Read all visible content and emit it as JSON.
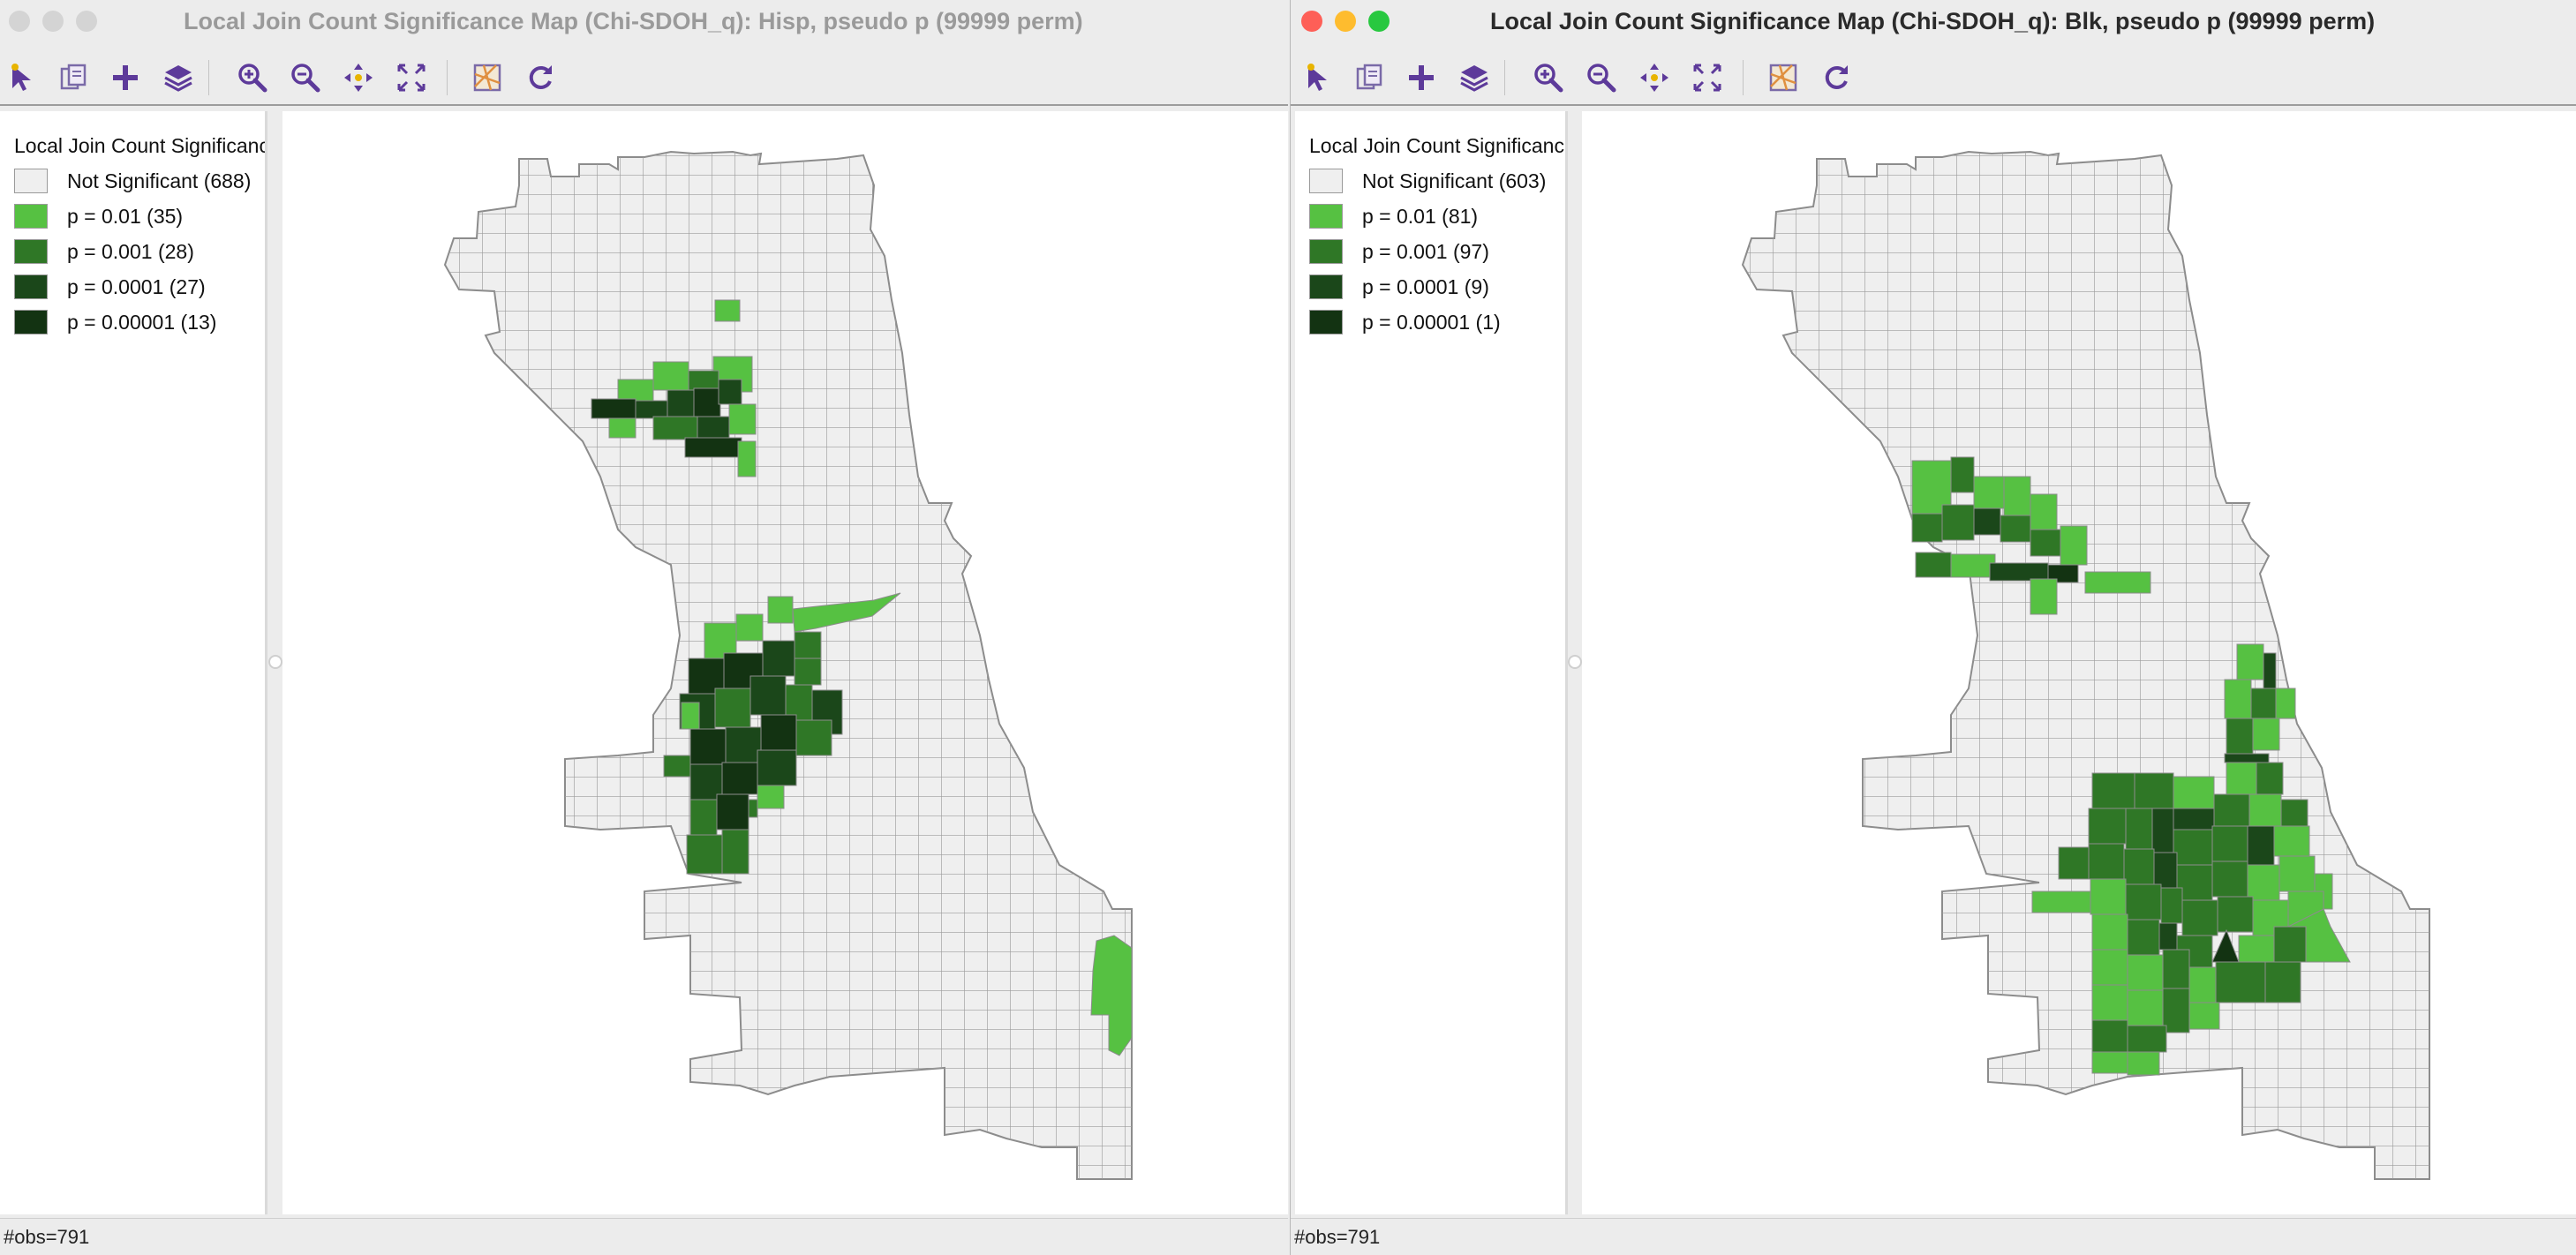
{
  "colors": {
    "not_significant": "#efefef",
    "p01": "#56c142",
    "p001": "#2f7726",
    "p0001": "#1b471a",
    "p00001": "#133312",
    "outline": "#999999",
    "toolbar_icon": "#5d3a9a"
  },
  "windows": [
    {
      "title": "Local Join Count Significance Map (Chi-SDOH_q): Hisp, pseudo p (99999 perm)",
      "active": false,
      "legend": {
        "title": "Local Join Count Significance Map",
        "items": [
          {
            "label": "Not Significant (688)",
            "color_key": "not_significant"
          },
          {
            "label": "p = 0.01 (35)",
            "color_key": "p01"
          },
          {
            "label": "p = 0.001 (28)",
            "color_key": "p001"
          },
          {
            "label": "p = 0.0001 (27)",
            "color_key": "p0001"
          },
          {
            "label": "p = 0.00001 (13)",
            "color_key": "p00001"
          }
        ]
      },
      "status": "#obs=791"
    },
    {
      "title": "Local Join Count Significance Map (Chi-SDOH_q): Blk, pseudo p (99999 perm)",
      "active": true,
      "legend": {
        "title": "Local Join Count Significance Map",
        "items": [
          {
            "label": "Not Significant (603)",
            "color_key": "not_significant"
          },
          {
            "label": "p = 0.01 (81)",
            "color_key": "p01"
          },
          {
            "label": "p = 0.001 (97)",
            "color_key": "p001"
          },
          {
            "label": "p = 0.0001 (9)",
            "color_key": "p0001"
          },
          {
            "label": "p = 0.00001 (1)",
            "color_key": "p00001"
          }
        ]
      },
      "status": "#obs=791"
    }
  ],
  "toolbar": {
    "tools": [
      "select-pointer-icon",
      "copy-image-icon",
      "add-icon",
      "layers-icon",
      "zoom-in-icon",
      "zoom-out-icon",
      "pan-icon",
      "fit-extent-icon",
      "basemap-icon",
      "refresh-icon"
    ]
  }
}
